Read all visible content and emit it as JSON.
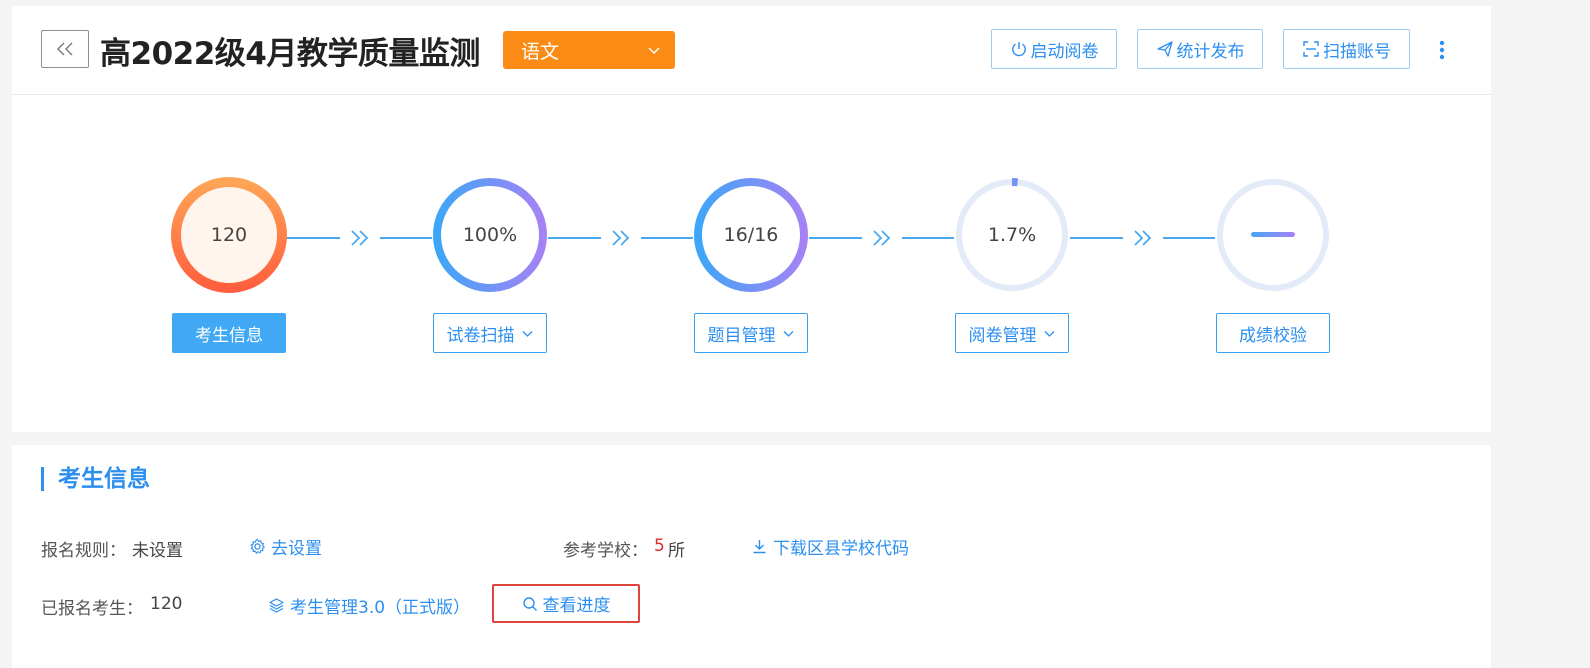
{
  "header": {
    "title": "高2022级4月教学质量监测",
    "subject": "语文",
    "buttons": {
      "start_marking": "启动阅卷",
      "publish_stats": "统计发布",
      "scan_account": "扫描账号"
    }
  },
  "workflow": {
    "steps": [
      {
        "value": "120",
        "label": "考生信息",
        "has_dropdown": false,
        "active": true,
        "progress": 1.0
      },
      {
        "value": "100%",
        "label": "试卷扫描",
        "has_dropdown": true,
        "active": false,
        "progress": 1.0
      },
      {
        "value": "16/16",
        "label": "题目管理",
        "has_dropdown": true,
        "active": false,
        "progress": 1.0
      },
      {
        "value": "1.7%",
        "label": "阅卷管理",
        "has_dropdown": true,
        "active": false,
        "progress": 0.017
      },
      {
        "value": "",
        "label": "成绩校验",
        "has_dropdown": false,
        "active": false,
        "progress": 0
      }
    ]
  },
  "info": {
    "section_title": "考生信息",
    "rule_label": "报名规则：",
    "rule_value": "未设置",
    "set_link": "去设置",
    "school_label": "参考学校：",
    "school_count": "5",
    "school_unit": "所",
    "download_link": "下载区县学校代码",
    "registered_label": "已报名考生：",
    "registered_value": "120",
    "manage_link": "考生管理3.0（正式版）",
    "progress_link": "查看进度"
  },
  "colors": {
    "accent": "#2c8ff0",
    "subject_bg": "#fa8c16",
    "highlight_border": "#e0443e",
    "count_red": "#e02a2a"
  }
}
